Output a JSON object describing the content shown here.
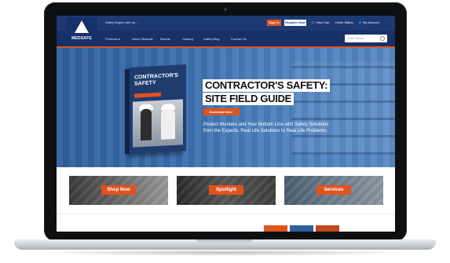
{
  "header": {
    "logo_text": "MEDSAFE",
    "tagline": "Safety begins with us...",
    "signin_label": "Sign In",
    "register_label": "Register Now",
    "cart_label": "View Cart",
    "order_status_label": "Order Status",
    "account_label": "My Account"
  },
  "nav": {
    "items": [
      "Products ▾",
      "About Medsafe",
      "Brands",
      "Catalog",
      "Safety Blog",
      "Contact Us"
    ],
    "search_placeholder": "Enter Search"
  },
  "hero": {
    "book_title": "CONTRACTOR'S SAFETY",
    "title_line1": "CONTRACTOR'S SAFETY:",
    "title_line2": "SITE FIELD GUIDE",
    "download_label": "Download Now ›",
    "body": "Protect Workers and Your Bottom Line with Safety Solutions from the Experts. Real Life Solutions to Real Life Problems.",
    "slides": 3,
    "active_slide": 1
  },
  "tiles": [
    {
      "label": "Shop Now"
    },
    {
      "label": "Spotlight"
    },
    {
      "label": "Services"
    }
  ],
  "colors": {
    "brand_navy": "#1d3a72",
    "accent_orange": "#e0531d"
  }
}
